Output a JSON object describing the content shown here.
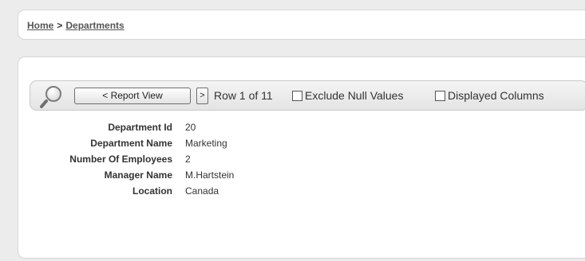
{
  "breadcrumb": {
    "home": "Home",
    "separator": ">",
    "current": "Departments"
  },
  "toolbar": {
    "search_icon": "search-magnifier-icon",
    "report_view_label": "< Report View",
    "next_label": ">",
    "row_counter": "Row 1 of 11",
    "exclude_null_label": "Exclude Null Values",
    "exclude_null_checked": false,
    "displayed_columns_label": "Displayed Columns",
    "displayed_columns_checked": false
  },
  "details": [
    {
      "label": "Department Id",
      "value": "20"
    },
    {
      "label": "Department Name",
      "value": "Marketing"
    },
    {
      "label": "Number Of Employees",
      "value": "2"
    },
    {
      "label": "Manager Name",
      "value": "M.Hartstein"
    },
    {
      "label": "Location",
      "value": "Canada"
    }
  ],
  "colors": {
    "page_background": "#ececec",
    "panel_background": "#ffffff",
    "panel_border": "#d6d6d6",
    "toolbar_background": "#e9e9e9"
  }
}
